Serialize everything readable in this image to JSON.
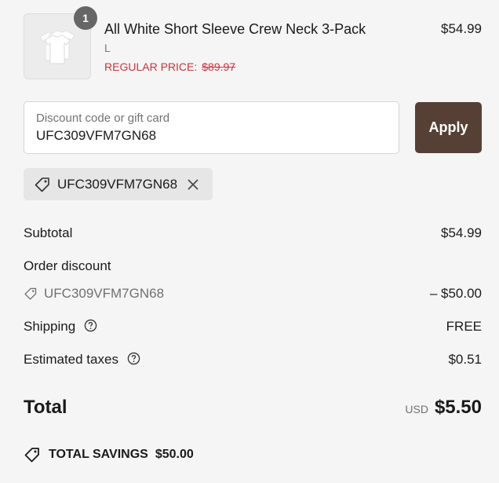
{
  "product": {
    "quantity": "1",
    "name": "All White Short Sleeve Crew Neck 3-Pack",
    "variant": "L",
    "regular_price_label": "REGULAR PRICE:",
    "regular_price": "$89.97",
    "price": "$54.99",
    "image_icon": "tshirt-3pack-image"
  },
  "discount": {
    "placeholder": "Discount code or gift card",
    "value": "UFC309VFM7GN68",
    "apply_label": "Apply",
    "applied_code": "UFC309VFM7GN68"
  },
  "summary": {
    "subtotal_label": "Subtotal",
    "subtotal_value": "$54.99",
    "order_discount_label": "Order discount",
    "order_discount_code": "UFC309VFM7GN68",
    "order_discount_value": "– $50.00",
    "shipping_label": "Shipping",
    "shipping_value": "FREE",
    "taxes_label": "Estimated taxes",
    "taxes_value": "$0.51",
    "total_label": "Total",
    "currency": "USD",
    "total_value": "$5.50",
    "savings_label": "TOTAL SAVINGS",
    "savings_value": "$50.00"
  },
  "colors": {
    "apply_button": "#564035",
    "regular_price": "#d0313a",
    "background": "#f5f5f5"
  }
}
